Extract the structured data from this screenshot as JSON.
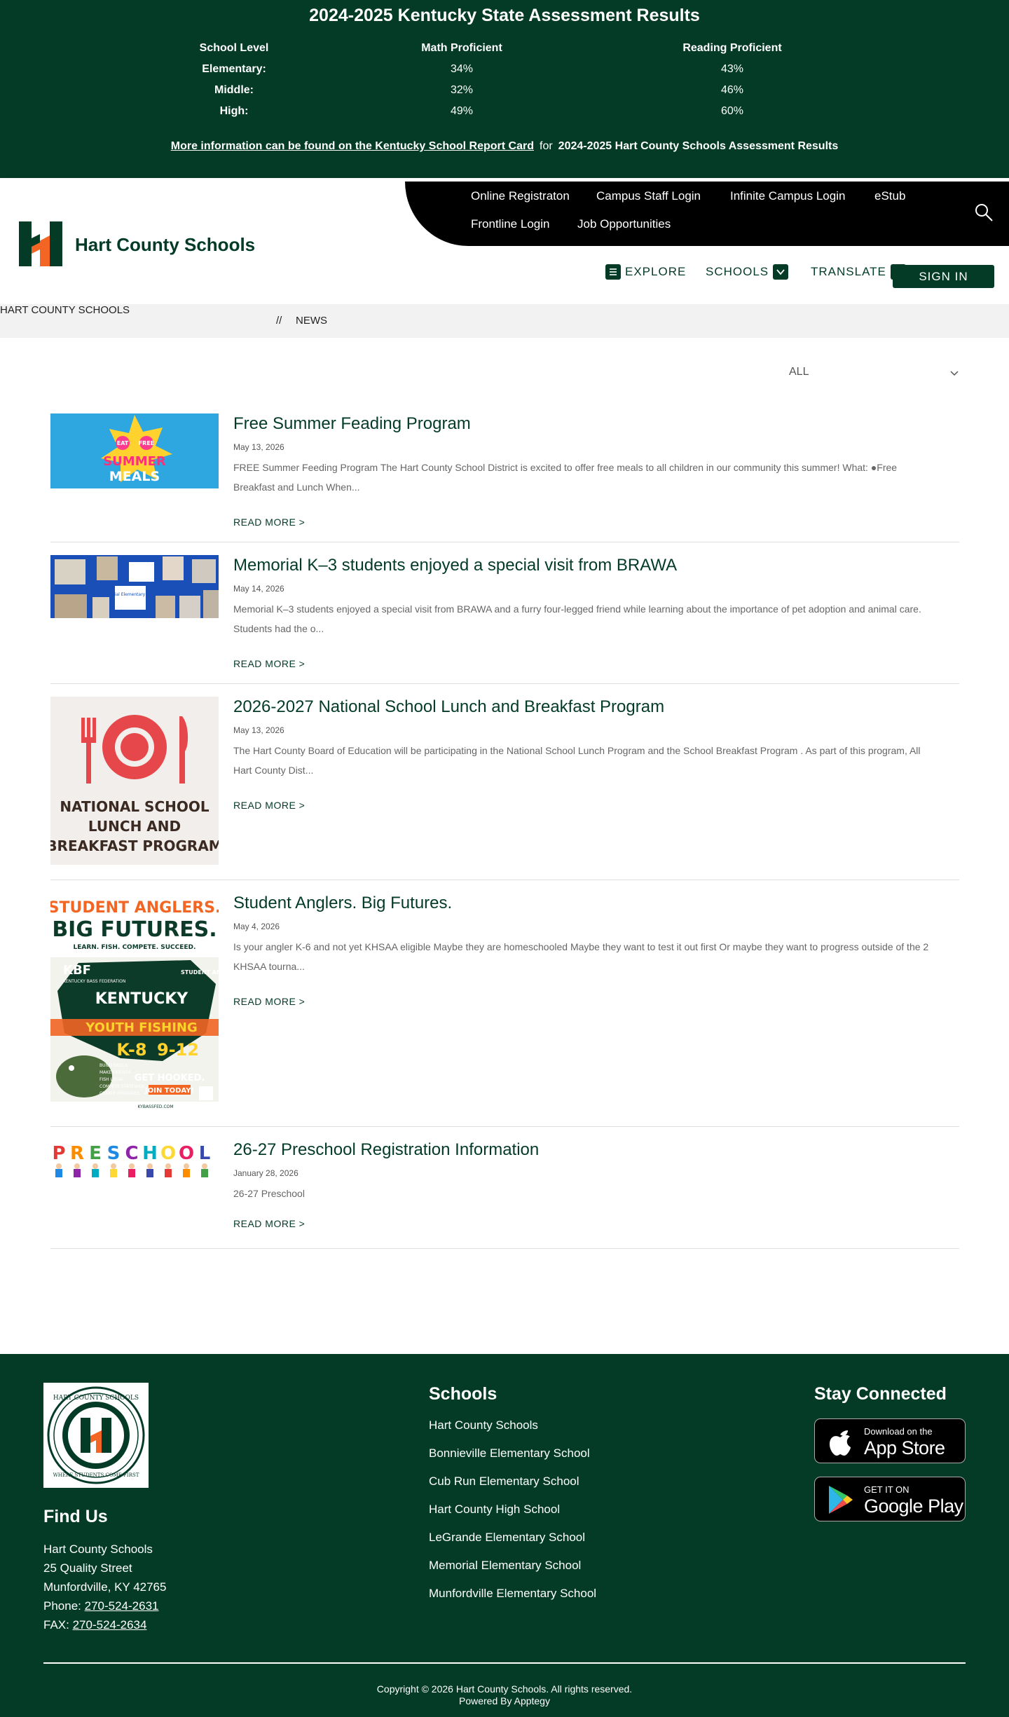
{
  "banner": {
    "title": "2024-2025 Kentucky State Assessment Results",
    "headers": {
      "level": "School Level",
      "math": "Math Proficient",
      "reading": "Reading Proficient"
    },
    "rows": [
      {
        "level": "Elementary:",
        "math": "34%",
        "reading": "43%"
      },
      {
        "level": "Middle:",
        "math": "32%",
        "reading": "46%"
      },
      {
        "level": "High:",
        "math": "49%",
        "reading": "60%"
      }
    ],
    "report_card_link": "More information can be found on the Kentucky School Report Card",
    "for_text": "for",
    "results_link": "2024-2025 Hart County Schools Assessment Results"
  },
  "header": {
    "site_name": "Hart County Schools",
    "quick_links": [
      "Online Registraton",
      "Campus Staff Login",
      "Infinite Campus Login",
      "eStub",
      "Frontline Login",
      "Job Opportunities"
    ],
    "nav": {
      "explore": "EXPLORE",
      "schools": "SCHOOLS",
      "translate": "TRANSLATE",
      "sign_in": "SIGN IN"
    }
  },
  "breadcrumb": {
    "home": "HART COUNTY SCHOOLS",
    "separator": "//",
    "current": "NEWS"
  },
  "filter": {
    "value": "ALL"
  },
  "articles": [
    {
      "title": "Free Summer Feading Program",
      "date": "May 13, 2026",
      "summary": "FREE Summer Feeding Program The Hart County School District is excited to offer free meals to all children in our community this summer! What: ●Free Breakfast and Lunch When...",
      "more": "READ MORE >",
      "image_text": {
        "eat": "EAT",
        "free": "FREE",
        "summer": "SUMMER",
        "meals": "MEALS"
      }
    },
    {
      "title": "Memorial K–3 students enjoyed a special visit from BRAWA",
      "date": "May 14, 2026",
      "summary": "Memorial K–3 students enjoyed a special visit from BRAWA and a furry four-legged friend while learning about the importance of pet adoption and animal care. Students had the o...",
      "more": "READ MORE >",
      "image_text": {
        "badge": "Memorial Elementary School"
      }
    },
    {
      "title": "2026-2027 National School Lunch and Breakfast Program",
      "date": "May 13, 2026",
      "summary": "The Hart County Board of Education will be participating in the National School Lunch Program and the School Breakfast Program . As part of this program, All Hart County Dist...",
      "more": "READ MORE >",
      "image_text": {
        "line1": "NATIONAL SCHOOL",
        "line2": "LUNCH AND",
        "line3": "BREAKFAST PROGRAM"
      }
    },
    {
      "title": "Student Anglers. Big Futures.",
      "date": "May 4, 2026",
      "summary": "Is your angler K-6 and not yet KHSAA eligible Maybe they are homeschooled Maybe they want to test it out first Or maybe they want to progress outside of the 2 KHSAA tourna...",
      "more": "READ MORE >",
      "image_text": {
        "headline1": "STUDENT ANGLERS.",
        "headline2": "BIG FUTURES.",
        "tagline": "LEARN. FISH. COMPETE. SUCCEED.",
        "kbf": "KBF",
        "kbf_sub": "KENTUCKY BASS FEDERATION",
        "sa": "STUDENT ANGLER FISHING",
        "state": "KENTUCKY",
        "youth": "YOUTH FISHING",
        "k8": "K-8",
        "g912": "9-12",
        "bullets": [
          "BUILD SKILLS",
          "MAKE FRIENDS",
          "FISH LOCAL",
          "COMPETE STATEWIDE",
          "CREATE MEMORIES"
        ],
        "hooked": "GET HOOKED.",
        "join": "JOIN TODAY!",
        "url": "KYBASSFED.COM"
      }
    },
    {
      "title": "26-27 Preschool Registration Information",
      "date": "January 28, 2026",
      "summary": "26-27 Preschool",
      "more": "READ MORE >",
      "image_text": {
        "letters": [
          "P",
          "R",
          "E",
          "S",
          "C",
          "H",
          "O",
          "O",
          "L"
        ]
      }
    }
  ],
  "footer": {
    "seal_text": {
      "top": "HART COUNTY SCHOOLS",
      "bottom": "WHERE STUDENTS COME FIRST"
    },
    "find_us": "Find Us",
    "address": [
      "Hart County Schools",
      "25 Quality Street",
      "Munfordville, KY 42765"
    ],
    "phone_label": "Phone:",
    "phone": "270-524-2631",
    "fax_label": "FAX:",
    "fax": "270-524-2634",
    "schools_heading": "Schools",
    "schools": [
      "Hart County Schools",
      "Bonnieville Elementary School",
      "Cub Run Elementary School",
      "Hart County High School",
      "LeGrande Elementary School",
      "Memorial Elementary School",
      "Munfordville Elementary School"
    ],
    "stay_connected": "Stay Connected",
    "app_store": {
      "small": "Download on the",
      "big": "App Store"
    },
    "google_play": {
      "small": "GET IT ON",
      "big": "Google Play"
    },
    "copyright": "Copyright © 2026 Hart County Schools. All rights reserved.",
    "powered": "Powered By Apptegy"
  },
  "colors": {
    "brand_green": "#033b27",
    "orange": "#f26522",
    "black_bar": "#000000",
    "crumb_bg": "#f2f2f2"
  }
}
